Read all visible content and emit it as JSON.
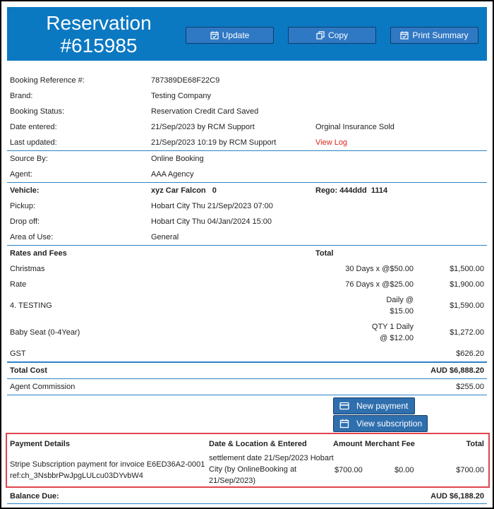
{
  "header": {
    "title_line1": "Reservation",
    "title_line2": "#615985",
    "buttons": {
      "update": "Update",
      "copy": "Copy",
      "print": "Print Summary"
    }
  },
  "details": {
    "booking_reference": {
      "label": "Booking Reference #:",
      "value": "787389DE68F22C9"
    },
    "brand": {
      "label": "Brand:",
      "value": "Testing Company"
    },
    "booking_status": {
      "label": "Booking Status:",
      "value": "Reservation Credit Card Saved"
    },
    "date_entered": {
      "label": "Date entered:",
      "value": "21/Sep/2023 by RCM Support",
      "note": "Orginal Insurance Sold"
    },
    "last_updated": {
      "label": "Last updated:",
      "value": "21/Sep/2023 10:19 by RCM Support",
      "link": "View Log"
    },
    "source_by": {
      "label": "Source By:",
      "value": "Online Booking"
    },
    "agent": {
      "label": "Agent:",
      "value": "AAA Agency"
    },
    "vehicle": {
      "label": "Vehicle:",
      "value": "xyz Car Falcon   0",
      "rego": "Rego: 444ddd  1114"
    },
    "pickup": {
      "label": "Pickup:",
      "value": "Hobart City Thu 21/Sep/2023 07:00"
    },
    "dropoff": {
      "label": "Drop off:",
      "value": "Hobart City Thu 04/Jan/2024 15:00"
    },
    "area_of_use": {
      "label": "Area of Use:",
      "value": "General"
    }
  },
  "rates": {
    "header": "Rates and Fees",
    "total_header": "Total",
    "items": [
      {
        "name": "Christmas",
        "qty": "30 Days x @$50.00",
        "total": "$1,500.00"
      },
      {
        "name": "Rate",
        "qty": "76 Days x @$25.00",
        "total": "$1,900.00"
      },
      {
        "name": "4. TESTING",
        "qty_line1": "Daily @",
        "qty_line2": "$15.00",
        "total": "$1,590.00"
      },
      {
        "name": "Baby Seat (0-4Year)",
        "qty_line1": "QTY 1 Daily",
        "qty_line2": "@ $12.00",
        "total": "$1,272.00"
      }
    ],
    "gst": {
      "label": "GST",
      "value": "$626.20"
    },
    "total_cost": {
      "label": "Total Cost",
      "value": "AUD $6,888.20"
    },
    "agent_commission": {
      "label": "Agent Commission",
      "value": "$255.00"
    }
  },
  "actions": {
    "new_payment": "New payment",
    "view_subscription": "View subscription"
  },
  "payments": {
    "headers": {
      "details": "Payment Details",
      "date_location": "Date & Location & Entered",
      "amount": "Amount",
      "merchant_fee": "Merchant Fee",
      "total": "Total"
    },
    "rows": [
      {
        "details_line1": "Stripe Subscription payment for invoice E6ED36A2-0001",
        "details_line2": "ref:ch_3NsbbrPwJpgLULcu03DYvbW4",
        "date_line1": "settlement date 21/Sep/2023 Hobart",
        "date_line2": "City (by OnlineBooking at",
        "date_line3": "21/Sep/2023)",
        "amount": "$700.00",
        "merchant_fee": "$0.00",
        "total": "$700.00"
      }
    ]
  },
  "balance_due": {
    "label": "Balance Due:",
    "value": "AUD $6,188.20"
  },
  "colors": {
    "header_bg": "#0b78c2",
    "button_bg": "#2f78c4",
    "divider": "#2d82c6",
    "highlight_border": "#e0444c",
    "link": "#d9241c"
  },
  "icons": {
    "update": "calendar-check-icon",
    "copy": "copy-icon",
    "print": "calendar-check-icon",
    "new_payment": "credit-card-icon",
    "view_subscription": "calendar-icon"
  }
}
